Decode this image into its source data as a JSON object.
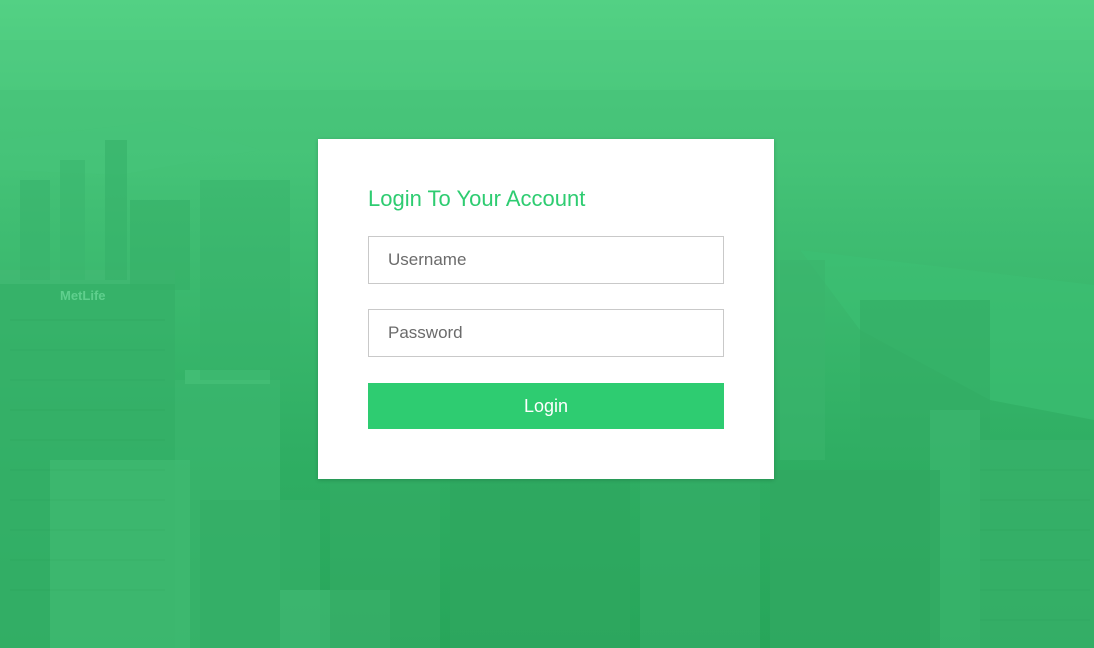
{
  "login": {
    "title": "Login To Your Account",
    "username_placeholder": "Username",
    "password_placeholder": "Password",
    "submit_label": "Login"
  },
  "background": {
    "sign_text": "MetLife"
  },
  "colors": {
    "accent": "#2ecc71",
    "overlay": "#3fbd72",
    "card": "#ffffff",
    "input_border": "#c9c9c9"
  }
}
